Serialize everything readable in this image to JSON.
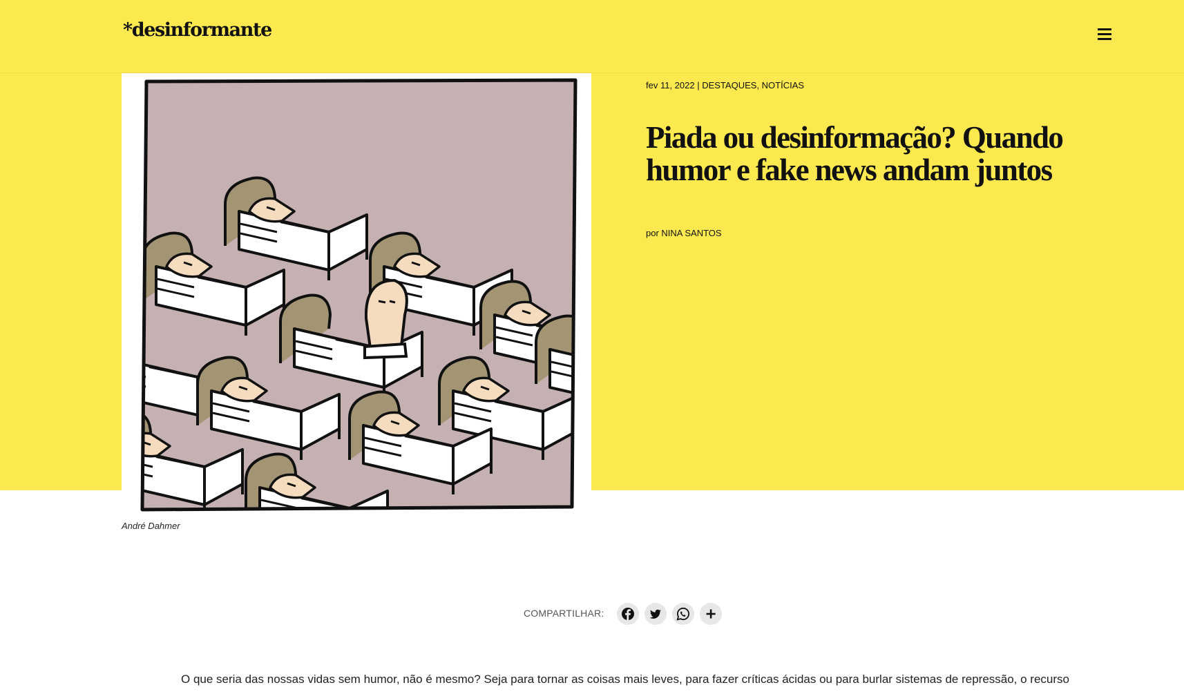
{
  "header": {
    "logo": "*desinformante",
    "menu_icon": "hamburger-menu-icon"
  },
  "article": {
    "date": "fev 11, 2022",
    "meta_separator": " | ",
    "categories": [
      "DESTAQUES",
      "NOTÍCIAS"
    ],
    "category_separator": ", ",
    "title": "Piada ou desinformação? Quando humor e fake news andam juntos",
    "byline_prefix": "por ",
    "author": "NINA SANTOS",
    "image_caption": "André Dahmer",
    "first_paragraph": "O que seria das nossas vidas sem humor, não é mesmo? Seja para tornar as coisas mais leves, para fazer críticas ácidas ou para burlar sistemas de repressão, o recurso"
  },
  "share": {
    "label": "COMPARTILHAR:",
    "buttons": [
      {
        "icon": "facebook-icon"
      },
      {
        "icon": "twitter-icon"
      },
      {
        "icon": "whatsapp-icon"
      },
      {
        "icon": "plus-icon"
      }
    ]
  },
  "colors": {
    "accent_yellow": "#fbe94f",
    "illustration_bg": "#c5b1b2",
    "bed_frame": "#a39474",
    "skin": "#f5dcbf"
  }
}
